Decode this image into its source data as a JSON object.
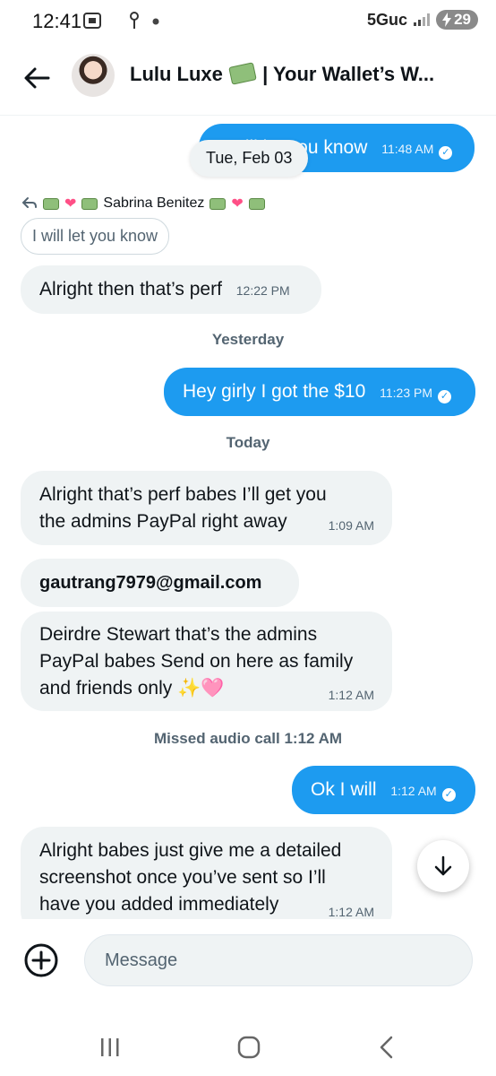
{
  "status_bar": {
    "time": "12:41",
    "network": "5Guc",
    "battery": "29"
  },
  "header": {
    "title_prefix": "Lulu Luxe",
    "title_suffix": "| Your Wallet’s W..."
  },
  "date_pill": "Tue, Feb 03",
  "messages": {
    "m1": {
      "text": "I will let you know",
      "time": "11:48 AM"
    },
    "reply_to_name": "Sabrina Benitez",
    "quoted": "I will let you know",
    "m2": {
      "text": "Alright then that’s perf",
      "time": "12:22 PM"
    },
    "divider_yesterday": "Yesterday",
    "m3": {
      "text": "Hey girly I got the $10",
      "time": "11:23 PM"
    },
    "divider_today": "Today",
    "m4": {
      "line1": "Alright that’s perf babes I’ll get you",
      "line2": "the admins PayPal right away",
      "time": "1:09 AM"
    },
    "m5": {
      "text": "gautrang7979@gmail.com"
    },
    "m6": {
      "line1": "Deirdre Stewart that’s the admins",
      "line2": "PayPal babes Send on here as family",
      "line3": "and friends only ✨🩷",
      "time": "1:12 AM"
    },
    "missed_call": "Missed audio call 1:12 AM",
    "m7": {
      "text": "Ok I will",
      "time": "1:12 AM"
    },
    "m8": {
      "line1": "Alright babes just give me a detailed",
      "line2": "screenshot once you’ve sent so I’ll",
      "line3": "have you added immediately",
      "time": "1:12 AM"
    }
  },
  "composer": {
    "placeholder": "Message"
  },
  "colors": {
    "accent": "#1d9bf0",
    "incoming": "#eff3f4",
    "muted": "#536471"
  }
}
